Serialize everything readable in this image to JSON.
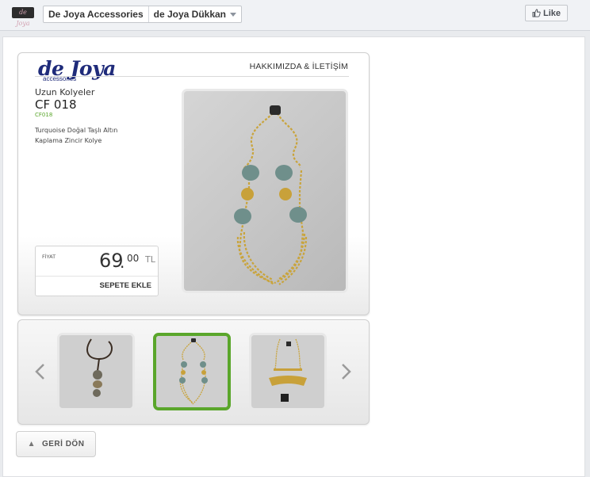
{
  "topbar": {
    "logo_text": "de Joya",
    "page_name": "De Joya Accessories",
    "tab_name": "de Joya Dükkan",
    "like_label": "Like"
  },
  "shop": {
    "brand": "de Joya",
    "brand_sub": "accessories",
    "nav_link": "HAKKIMIZDA & İLETİŞİM",
    "category": "Uzun Kolyeler",
    "product_name": "CF 018",
    "product_code": "CF018",
    "description": "Turquoise Doğal Taşlı Altın Kaplama Zincir Kolye",
    "price_label": "FİYAT",
    "price_int": "69",
    "price_dot": ".",
    "price_dec": "00",
    "price_currency": "TL",
    "add_to_cart": "SEPETE EKLE"
  },
  "thumbnails": {
    "prev_icon": "chevron-left-icon",
    "next_icon": "chevron-right-icon",
    "selected_index": 1,
    "items": [
      {
        "name": "pendant-stone-necklace"
      },
      {
        "name": "turquoise-chain-necklace"
      },
      {
        "name": "bar-pendant-necklace"
      }
    ]
  },
  "back_button": {
    "icon": "back-arrow-icon",
    "label": "GERİ DÖN"
  },
  "colors": {
    "accent_green": "#5aa62b",
    "brand_blue": "#1f2b7a"
  }
}
